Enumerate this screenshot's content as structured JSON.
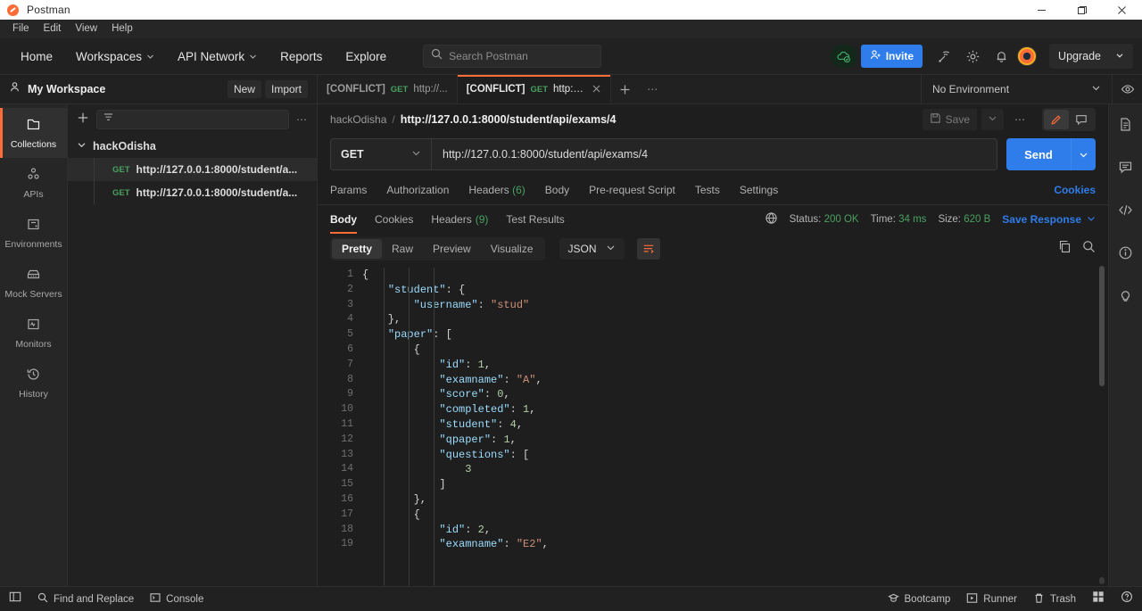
{
  "titlebar": {
    "app_title": "Postman"
  },
  "menubar": {
    "items": [
      "File",
      "Edit",
      "View",
      "Help"
    ]
  },
  "navbar": {
    "links": [
      {
        "label": "Home",
        "caret": false
      },
      {
        "label": "Workspaces",
        "caret": true
      },
      {
        "label": "API Network",
        "caret": true
      },
      {
        "label": "Reports",
        "caret": false
      },
      {
        "label": "Explore",
        "caret": false
      }
    ],
    "search_placeholder": "Search Postman",
    "invite_label": "Invite",
    "upgrade_label": "Upgrade"
  },
  "workspace": {
    "name": "My Workspace",
    "new_label": "New",
    "import_label": "Import"
  },
  "tabs": [
    {
      "conflict": "[CONFLICT]",
      "method": "GET",
      "url": "http://...",
      "active": false
    },
    {
      "conflict": "[CONFLICT]",
      "method": "GET",
      "url": "http://...",
      "active": true
    }
  ],
  "environment": {
    "selected": "No Environment"
  },
  "rail": [
    {
      "label": "Collections",
      "icon": "collections-icon",
      "active": true
    },
    {
      "label": "APIs",
      "icon": "apis-icon",
      "active": false
    },
    {
      "label": "Environments",
      "icon": "environments-icon",
      "active": false
    },
    {
      "label": "Mock Servers",
      "icon": "mock-servers-icon",
      "active": false
    },
    {
      "label": "Monitors",
      "icon": "monitors-icon",
      "active": false
    },
    {
      "label": "History",
      "icon": "history-icon",
      "active": false
    }
  ],
  "sidebar": {
    "collection_name": "hackOdisha",
    "requests": [
      {
        "method": "GET",
        "url": "http://127.0.0.1:8000/student/a...",
        "selected": true
      },
      {
        "method": "GET",
        "url": "http://127.0.0.1:8000/student/a...",
        "selected": false
      }
    ]
  },
  "breadcrumb": {
    "collection": "hackOdisha",
    "separator": "/",
    "request_name": "http://127.0.0.1:8000/student/api/exams/4",
    "save_label": "Save"
  },
  "request": {
    "method": "GET",
    "url": "http://127.0.0.1:8000/student/api/exams/4",
    "send_label": "Send",
    "tabs": [
      {
        "label": "Params",
        "count": ""
      },
      {
        "label": "Authorization",
        "count": ""
      },
      {
        "label": "Headers",
        "count": "(6)"
      },
      {
        "label": "Body",
        "count": ""
      },
      {
        "label": "Pre-request Script",
        "count": ""
      },
      {
        "label": "Tests",
        "count": ""
      },
      {
        "label": "Settings",
        "count": ""
      }
    ],
    "cookies_link": "Cookies"
  },
  "response": {
    "tabs": [
      {
        "label": "Body",
        "count": "",
        "active": true
      },
      {
        "label": "Cookies",
        "count": "",
        "active": false
      },
      {
        "label": "Headers",
        "count": "(9)",
        "active": false
      },
      {
        "label": "Test Results",
        "count": "",
        "active": false
      }
    ],
    "status_label": "Status:",
    "status_value": "200 OK",
    "time_label": "Time:",
    "time_value": "34 ms",
    "size_label": "Size:",
    "size_value": "620 B",
    "save_response_label": "Save Response",
    "formats": [
      {
        "label": "Pretty",
        "active": true
      },
      {
        "label": "Raw",
        "active": false
      },
      {
        "label": "Preview",
        "active": false
      },
      {
        "label": "Visualize",
        "active": false
      }
    ],
    "content_type": "JSON",
    "line_numbers": [
      "1",
      "2",
      "3",
      "4",
      "5",
      "6",
      "7",
      "8",
      "9",
      "10",
      "11",
      "12",
      "13",
      "14",
      "15",
      "16",
      "17",
      "18",
      "19"
    ],
    "body_lines": [
      [
        {
          "t": "{",
          "c": "p"
        }
      ],
      [
        {
          "t": "    ",
          "c": "p"
        },
        {
          "t": "\"student\"",
          "c": "k"
        },
        {
          "t": ": {",
          "c": "p"
        }
      ],
      [
        {
          "t": "        ",
          "c": "p"
        },
        {
          "t": "\"username\"",
          "c": "k"
        },
        {
          "t": ": ",
          "c": "p"
        },
        {
          "t": "\"stud\"",
          "c": "s"
        }
      ],
      [
        {
          "t": "    },",
          "c": "p"
        }
      ],
      [
        {
          "t": "    ",
          "c": "p"
        },
        {
          "t": "\"paper\"",
          "c": "k"
        },
        {
          "t": ": [",
          "c": "p"
        }
      ],
      [
        {
          "t": "        {",
          "c": "p"
        }
      ],
      [
        {
          "t": "            ",
          "c": "p"
        },
        {
          "t": "\"id\"",
          "c": "k"
        },
        {
          "t": ": ",
          "c": "p"
        },
        {
          "t": "1",
          "c": "n"
        },
        {
          "t": ",",
          "c": "p"
        }
      ],
      [
        {
          "t": "            ",
          "c": "p"
        },
        {
          "t": "\"examname\"",
          "c": "k"
        },
        {
          "t": ": ",
          "c": "p"
        },
        {
          "t": "\"A\"",
          "c": "s"
        },
        {
          "t": ",",
          "c": "p"
        }
      ],
      [
        {
          "t": "            ",
          "c": "p"
        },
        {
          "t": "\"score\"",
          "c": "k"
        },
        {
          "t": ": ",
          "c": "p"
        },
        {
          "t": "0",
          "c": "n"
        },
        {
          "t": ",",
          "c": "p"
        }
      ],
      [
        {
          "t": "            ",
          "c": "p"
        },
        {
          "t": "\"completed\"",
          "c": "k"
        },
        {
          "t": ": ",
          "c": "p"
        },
        {
          "t": "1",
          "c": "n"
        },
        {
          "t": ",",
          "c": "p"
        }
      ],
      [
        {
          "t": "            ",
          "c": "p"
        },
        {
          "t": "\"student\"",
          "c": "k"
        },
        {
          "t": ": ",
          "c": "p"
        },
        {
          "t": "4",
          "c": "n"
        },
        {
          "t": ",",
          "c": "p"
        }
      ],
      [
        {
          "t": "            ",
          "c": "p"
        },
        {
          "t": "\"qpaper\"",
          "c": "k"
        },
        {
          "t": ": ",
          "c": "p"
        },
        {
          "t": "1",
          "c": "n"
        },
        {
          "t": ",",
          "c": "p"
        }
      ],
      [
        {
          "t": "            ",
          "c": "p"
        },
        {
          "t": "\"questions\"",
          "c": "k"
        },
        {
          "t": ": [",
          "c": "p"
        }
      ],
      [
        {
          "t": "                ",
          "c": "p"
        },
        {
          "t": "3",
          "c": "n"
        }
      ],
      [
        {
          "t": "            ]",
          "c": "p"
        }
      ],
      [
        {
          "t": "        },",
          "c": "p"
        }
      ],
      [
        {
          "t": "        {",
          "c": "p"
        }
      ],
      [
        {
          "t": "            ",
          "c": "p"
        },
        {
          "t": "\"id\"",
          "c": "k"
        },
        {
          "t": ": ",
          "c": "p"
        },
        {
          "t": "2",
          "c": "n"
        },
        {
          "t": ",",
          "c": "p"
        }
      ],
      [
        {
          "t": "            ",
          "c": "p"
        },
        {
          "t": "\"examname\"",
          "c": "k"
        },
        {
          "t": ": ",
          "c": "p"
        },
        {
          "t": "\"E2\"",
          "c": "s"
        },
        {
          "t": ",",
          "c": "p"
        }
      ]
    ]
  },
  "footer": {
    "left": [
      {
        "label": "Find and Replace",
        "icon": "search-icon"
      },
      {
        "label": "Console",
        "icon": "console-icon"
      }
    ],
    "right": [
      {
        "label": "Bootcamp",
        "icon": "bootcamp-icon"
      },
      {
        "label": "Runner",
        "icon": "runner-icon"
      },
      {
        "label": "Trash",
        "icon": "trash-icon"
      }
    ]
  },
  "colors": {
    "accent": "#ff6c37",
    "blue": "#2f7ceb",
    "green": "#49a160",
    "bg": "#1e1e1e"
  }
}
